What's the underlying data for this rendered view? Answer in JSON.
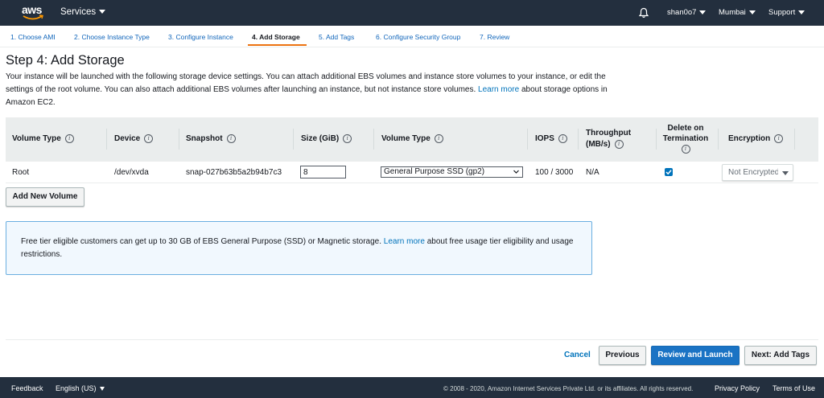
{
  "topnav": {
    "logo_text": "aws",
    "services_label": "Services",
    "user_label": "shan0o7",
    "region_label": "Mumbai",
    "support_label": "Support"
  },
  "steps": [
    {
      "label": "1. Choose AMI"
    },
    {
      "label": "2. Choose Instance Type"
    },
    {
      "label": "3. Configure Instance"
    },
    {
      "label": "4. Add Storage"
    },
    {
      "label": "5. Add Tags"
    },
    {
      "label": "6. Configure Security Group"
    },
    {
      "label": "7. Review"
    }
  ],
  "page": {
    "title": "Step 4: Add Storage",
    "description_before": "Your instance will be launched with the following storage device settings. You can attach additional EBS volumes and instance store volumes to your instance, or edit the settings of the root volume. You can also attach additional EBS volumes after launching an instance, but not instance store volumes.",
    "learn_more": "Learn more",
    "description_after": "about storage options in Amazon EC2."
  },
  "table": {
    "headers": {
      "volume_type": "Volume Type",
      "device": "Device",
      "snapshot": "Snapshot",
      "size": "Size (GiB)",
      "ebs_type": "Volume Type",
      "iops": "IOPS",
      "throughput_1": "Throughput",
      "throughput_2": "(MB/s)",
      "delete_1": "Delete on",
      "delete_2": "Termination",
      "encryption": "Encryption"
    },
    "row": {
      "volume_type": "Root",
      "device": "/dev/xvda",
      "snapshot": "snap-027b63b5a2b94b7c3",
      "size": "8",
      "ebs_type": "General Purpose SSD (gp2)",
      "iops": "100 / 3000",
      "throughput": "N/A",
      "encryption": "Not Encrypted"
    }
  },
  "add_volume_label": "Add New Volume",
  "info_box": {
    "text_before": "Free tier eligible customers can get up to 30 GB of EBS General Purpose (SSD) or Magnetic storage.",
    "learn_more": "Learn more",
    "text_after": "about free usage tier eligibility and usage restrictions."
  },
  "actions": {
    "cancel": "Cancel",
    "previous": "Previous",
    "review_launch": "Review and Launch",
    "next": "Next: Add Tags"
  },
  "footer": {
    "feedback": "Feedback",
    "language": "English (US)",
    "copyright": "© 2008 - 2020, Amazon Internet Services Private Ltd. or its affiliates. All rights reserved.",
    "privacy": "Privacy Policy",
    "terms": "Terms of Use"
  },
  "colors": {
    "nav_bg": "#232f3e",
    "link": "#0073bb",
    "primary": "#1a73c4",
    "active_step": "#ec7211"
  }
}
